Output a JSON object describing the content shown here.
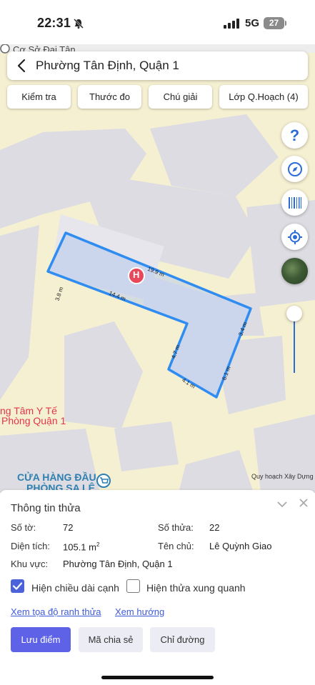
{
  "status_bar": {
    "time": "22:31",
    "network": "5G",
    "battery": "27"
  },
  "search": {
    "title": "Phường Tân Định, Quận 1"
  },
  "toolbar": {
    "chips": [
      "Kiểm tra",
      "Thước đo",
      "Chú giải",
      "Lớp Q.Hoạch (4)"
    ]
  },
  "map": {
    "top_label": "Cơ Sở Đại Tân",
    "poi_medical_line1": "ng Tâm Y Tế",
    "poi_medical_line2": "Phòng Quận 1",
    "poi_store_line1": "CỬA HÀNG ĐẦU",
    "poi_store_line2": "PHÒNG SA LÊ",
    "credit": "Quy hoạch Xây Dựng",
    "hospital_marker": "H",
    "edge_labels": [
      "3.8 m",
      "19.9 m",
      "14.4 m",
      "3.4 m",
      "4.7 m",
      "6.1 m",
      "4.1 m"
    ],
    "plot_color": "#2f8cf0"
  },
  "panel": {
    "title": "Thông tin thửa",
    "so_to_label": "Số tờ:",
    "so_to_value": "72",
    "so_thua_label": "Số thửa:",
    "so_thua_value": "22",
    "dien_tich_label": "Diện tích:",
    "dien_tich_value": "105.1 m",
    "dien_tich_unit_sup": "2",
    "ten_chu_label": "Tên chủ:",
    "ten_chu_value": "Lê Quỳnh Giao",
    "khu_vuc_label": "Khu vực:",
    "khu_vuc_value": "Phường Tân Định, Quận 1",
    "checkbox_edges": {
      "label": "Hiện chiều dài cạnh",
      "checked": true
    },
    "checkbox_neighbors": {
      "label": "Hiện thửa xung quanh",
      "checked": false
    },
    "link_coords": "Xem tọa độ ranh thửa",
    "link_direction": "Xem hướng",
    "btn_save": "Lưu điểm",
    "btn_share": "Mã chia sẻ",
    "btn_route": "Chỉ đường",
    "accent_color": "#5d62e6"
  }
}
